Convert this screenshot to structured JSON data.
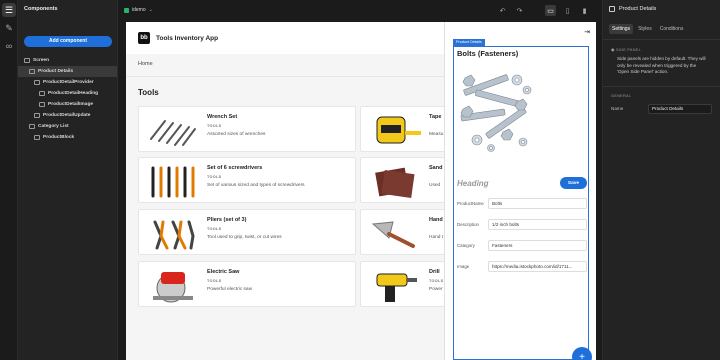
{
  "components_panel": {
    "title": "Components",
    "add_button": "Add component",
    "tree": [
      {
        "label": "Screen",
        "indent": 0,
        "selected": false
      },
      {
        "label": "Product Details",
        "indent": 1,
        "selected": true
      },
      {
        "label": "ProductDetailProvider",
        "indent": 2,
        "selected": false
      },
      {
        "label": "ProductDetailHeading",
        "indent": 3,
        "selected": false
      },
      {
        "label": "ProductDetailImage",
        "indent": 3,
        "selected": false
      },
      {
        "label": "ProductDetailUpdate",
        "indent": 2,
        "selected": false
      },
      {
        "label": "Category List",
        "indent": 1,
        "selected": false
      },
      {
        "label": "ProductBlock",
        "indent": 2,
        "selected": false
      }
    ]
  },
  "topbar": {
    "app_label": "idemo",
    "brand_color": "#2bb36a"
  },
  "app": {
    "logo": "bb",
    "name": "Tools Inventory App",
    "nav_home": "Home",
    "section_title": "Tools",
    "cards": [
      {
        "title": "Wrench Set",
        "category": "TOOLS",
        "desc": "Assorted sizes of wrenches",
        "icon": "wrench-set-image"
      },
      {
        "title": "Tape",
        "category": "",
        "desc": "Measu",
        "icon": "tape-measure-image"
      },
      {
        "title": "Set of 6 screwdrivers",
        "category": "TOOLS",
        "desc": "Set of various sized and types of screwdrivers",
        "icon": "screwdrivers-image"
      },
      {
        "title": "Sand",
        "category": "",
        "desc": "Used",
        "icon": "sandpaper-image"
      },
      {
        "title": "Pliers (set of 3)",
        "category": "TOOLS",
        "desc": "Tool used to grip, twist, or cut wires",
        "icon": "pliers-image"
      },
      {
        "title": "Hand",
        "category": "",
        "desc": "Hand t",
        "icon": "trowel-image"
      },
      {
        "title": "Electric Saw",
        "category": "TOOLS",
        "desc": "Powerful electric saw",
        "icon": "circular-saw-image"
      },
      {
        "title": "Drill",
        "category": "TOOLS",
        "desc": "Power",
        "icon": "drill-image"
      }
    ]
  },
  "side_panel": {
    "tag": "Product Details",
    "title": "Bolts (Fasteners)",
    "heading_placeholder": "Heading",
    "save_label": "Save",
    "fields": [
      {
        "label": "ProductName",
        "value": "Bolts"
      },
      {
        "label": "Description",
        "value": "1/2 inch bolts"
      },
      {
        "label": "Category",
        "value": "Fasteners"
      },
      {
        "label": "Image",
        "value": "https://media.istockphoto.com/id/1711..."
      }
    ],
    "fab_label": "+"
  },
  "settings_panel": {
    "title": "Product Details",
    "tabs": [
      "Settings",
      "Styles",
      "Conditions"
    ],
    "active_tab": "Settings",
    "side_panel_section": "SIDE PANEL",
    "side_panel_desc": "Side panels are hidden by default. They will only be revealed when triggered by the 'Open Side Panel' action.",
    "general_section": "GENERAL",
    "name_label": "Name",
    "name_value": "Product Details"
  },
  "accent_color": "#1e6fd9"
}
